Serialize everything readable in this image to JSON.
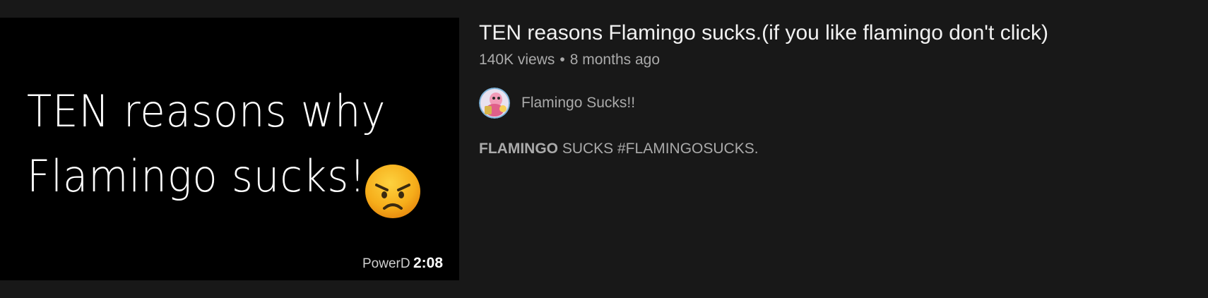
{
  "video": {
    "thumbnail": {
      "line1": "TEN reasons why",
      "line2": "Flamingo sucks!",
      "watermark": "PowerD",
      "duration": "2:08",
      "emoji": "angry-face-icon"
    },
    "title": "TEN reasons Flamingo sucks.(if you like flamingo don't click)",
    "views": "140K views",
    "separator": "•",
    "age": "8 months ago",
    "channel": {
      "name": "Flamingo Sucks!!",
      "avatar": "channel-avatar"
    },
    "description": {
      "highlight": "FLAMINGO",
      "rest": " SUCKS #FLAMINGOSUCKS."
    }
  },
  "colors": {
    "background": "#181818",
    "thumbnail_bg": "#000000",
    "title": "#f1f1f1",
    "secondary_text": "#aaaaaa",
    "emoji_yellow": "#f9b825"
  }
}
